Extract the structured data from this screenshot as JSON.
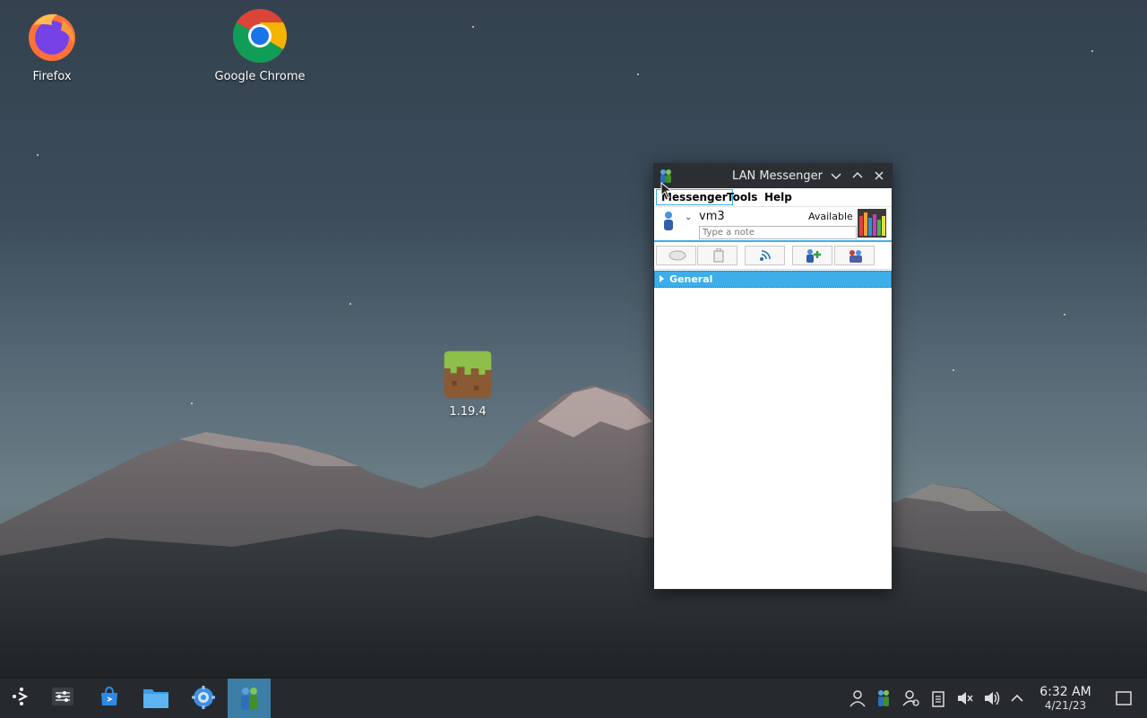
{
  "desktop": {
    "icons": [
      {
        "label": "Firefox"
      },
      {
        "label": "Google Chrome"
      },
      {
        "label": "1.19.4"
      }
    ]
  },
  "window": {
    "title": "LAN Messenger",
    "menu": [
      "Messenger",
      "Tools",
      "Help"
    ],
    "user": {
      "name": "vm3",
      "status": "Available",
      "note_placeholder": "Type a note"
    },
    "toolbar_icons": [
      "chat-icon",
      "file-transfer-icon",
      "broadcast-icon",
      "add-contact-icon",
      "group-icon"
    ],
    "groups": [
      {
        "label": "General"
      }
    ]
  },
  "taskbar": {
    "apps": [
      "launcher-icon",
      "settings-sliders-icon",
      "store-icon",
      "file-manager-icon",
      "system-settings-icon",
      "lan-messenger-icon"
    ],
    "tray_icons": [
      "user-icon",
      "lan-messenger-tray-icon",
      "network-icon",
      "clipboard-icon",
      "mute-icon",
      "volume-icon",
      "expand-tray-icon"
    ],
    "clock": {
      "time": "6:32 AM",
      "date": "4/21/23"
    }
  },
  "colors": {
    "accent": "#3daee9",
    "taskbar": "#262a2e",
    "titlebar": "#2b2f33"
  }
}
